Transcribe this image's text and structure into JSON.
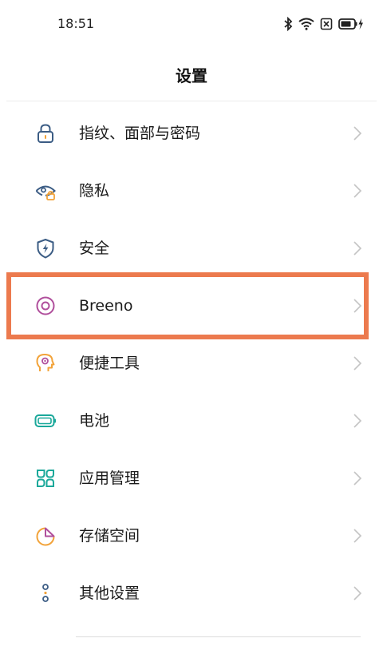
{
  "status_bar": {
    "time": "18:51"
  },
  "header": {
    "title": "设置"
  },
  "items": [
    {
      "label": "指纹、面部与密码",
      "icon": "lock-icon"
    },
    {
      "label": "隐私",
      "icon": "privacy-eye-icon"
    },
    {
      "label": "安全",
      "icon": "security-shield-icon"
    },
    {
      "label": "Breeno",
      "icon": "breeno-icon"
    },
    {
      "label": "便捷工具",
      "icon": "convenience-tools-icon"
    },
    {
      "label": "电池",
      "icon": "battery-icon"
    },
    {
      "label": "应用管理",
      "icon": "app-management-icon"
    },
    {
      "label": "存储空间",
      "icon": "storage-icon"
    },
    {
      "label": "其他设置",
      "icon": "other-settings-icon"
    }
  ],
  "colors": {
    "highlight": "#ec7a4e",
    "icon_blue": "#3b5c84",
    "breeno": "#b04f9c",
    "tools": "#f2a33a",
    "battery": "#1aa89a",
    "apps": "#1aa89a",
    "storage": "#f2a33a"
  }
}
